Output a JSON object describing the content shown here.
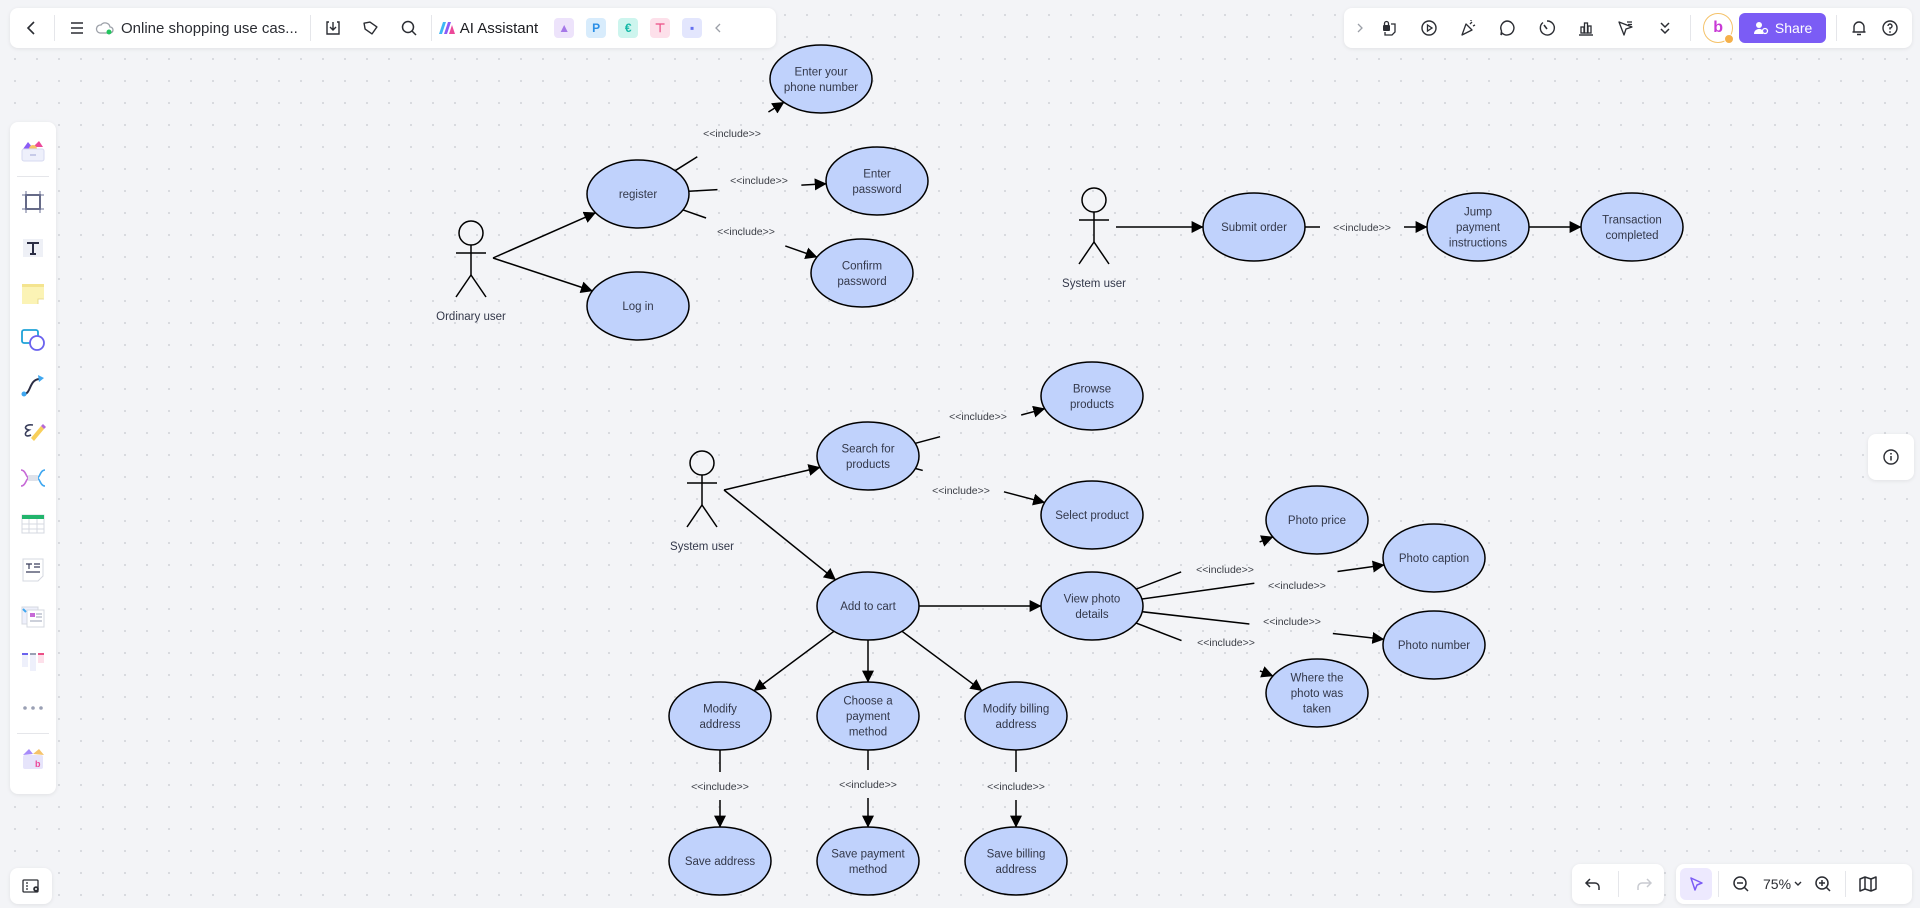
{
  "toolbar": {
    "doc_title": "Online shopping use cas...",
    "ai_assistant_label": "AI Assistant",
    "share_label": "Share",
    "zoom_level": "75%",
    "sync_status_color": "#22c55e",
    "accent_color": "#7b5cf5"
  },
  "app_shortcuts": [
    {
      "name": "image-generator",
      "glyph": "▲",
      "bg": "#ede3fb",
      "fg": "#a678e8"
    },
    {
      "name": "presentation",
      "glyph": "P",
      "bg": "#d8ecfc",
      "fg": "#2b8fe6"
    },
    {
      "name": "mindmap",
      "glyph": "€",
      "bg": "#cdf5ee",
      "fg": "#14b8a6"
    },
    {
      "name": "flowchart",
      "glyph": "⊤",
      "bg": "#fde0ea",
      "fg": "#ec4f86"
    },
    {
      "name": "chat",
      "glyph": "▪",
      "bg": "#e3e6fd",
      "fg": "#6470f0"
    }
  ],
  "diagram": {
    "ellipse_fill": "#c0d2fc",
    "stroke": "#000000",
    "include_label": "<<include>>",
    "actors": [
      {
        "id": "ordinary-user",
        "label": "Ordinary user"
      },
      {
        "id": "system-user-1",
        "label": "System user"
      },
      {
        "id": "system-user-2",
        "label": "System user"
      }
    ],
    "use_cases": [
      {
        "id": "register",
        "lines": [
          "register"
        ]
      },
      {
        "id": "log-in",
        "lines": [
          "Log in"
        ]
      },
      {
        "id": "enter-phone",
        "lines": [
          "Enter your",
          "phone number"
        ]
      },
      {
        "id": "enter-password",
        "lines": [
          "Enter",
          "password"
        ]
      },
      {
        "id": "confirm-password",
        "lines": [
          "Confirm",
          "password"
        ]
      },
      {
        "id": "submit-order",
        "lines": [
          "Submit order"
        ]
      },
      {
        "id": "jump-payment",
        "lines": [
          "Jump",
          "payment",
          "instructions"
        ]
      },
      {
        "id": "transaction-completed",
        "lines": [
          "Transaction",
          "completed"
        ]
      },
      {
        "id": "search-products",
        "lines": [
          "Search for",
          "products"
        ]
      },
      {
        "id": "browse-products",
        "lines": [
          "Browse",
          "products"
        ]
      },
      {
        "id": "select-product",
        "lines": [
          "Select product"
        ]
      },
      {
        "id": "add-to-cart",
        "lines": [
          "Add to cart"
        ]
      },
      {
        "id": "view-photo-details",
        "lines": [
          "View photo",
          "details"
        ]
      },
      {
        "id": "photo-price",
        "lines": [
          "Photo price"
        ]
      },
      {
        "id": "photo-caption",
        "lines": [
          "Photo caption"
        ]
      },
      {
        "id": "photo-number",
        "lines": [
          "Photo number"
        ]
      },
      {
        "id": "photo-location",
        "lines": [
          "Where the",
          "photo was",
          "taken"
        ]
      },
      {
        "id": "modify-address",
        "lines": [
          "Modify",
          "address"
        ]
      },
      {
        "id": "choose-payment",
        "lines": [
          "Choose a",
          "payment",
          "method"
        ]
      },
      {
        "id": "modify-billing",
        "lines": [
          "Modify billing",
          "address"
        ]
      },
      {
        "id": "save-address",
        "lines": [
          "Save address"
        ]
      },
      {
        "id": "save-payment",
        "lines": [
          "Save payment",
          "method"
        ]
      },
      {
        "id": "save-billing",
        "lines": [
          "Save billing",
          "address"
        ]
      }
    ],
    "relations": [
      {
        "from": "ordinary-user",
        "to": "register",
        "include": false
      },
      {
        "from": "ordinary-user",
        "to": "log-in",
        "include": false
      },
      {
        "from": "register",
        "to": "enter-phone",
        "include": true
      },
      {
        "from": "register",
        "to": "enter-password",
        "include": true
      },
      {
        "from": "register",
        "to": "confirm-password",
        "include": true
      },
      {
        "from": "system-user-1",
        "to": "submit-order",
        "include": false
      },
      {
        "from": "submit-order",
        "to": "jump-payment",
        "include": true
      },
      {
        "from": "jump-payment",
        "to": "transaction-completed",
        "include": false
      },
      {
        "from": "system-user-2",
        "to": "search-products",
        "include": false
      },
      {
        "from": "system-user-2",
        "to": "add-to-cart",
        "include": false
      },
      {
        "from": "search-products",
        "to": "browse-products",
        "include": true
      },
      {
        "from": "search-products",
        "to": "select-product",
        "include": true
      },
      {
        "from": "add-to-cart",
        "to": "view-photo-details",
        "include": false
      },
      {
        "from": "view-photo-details",
        "to": "photo-price",
        "include": true
      },
      {
        "from": "view-photo-details",
        "to": "photo-caption",
        "include": true
      },
      {
        "from": "view-photo-details",
        "to": "photo-number",
        "include": true
      },
      {
        "from": "view-photo-details",
        "to": "photo-location",
        "include": true
      },
      {
        "from": "add-to-cart",
        "to": "modify-address",
        "include": false
      },
      {
        "from": "add-to-cart",
        "to": "choose-payment",
        "include": false
      },
      {
        "from": "add-to-cart",
        "to": "modify-billing",
        "include": false
      },
      {
        "from": "modify-address",
        "to": "save-address",
        "include": true
      },
      {
        "from": "choose-payment",
        "to": "save-payment",
        "include": true
      },
      {
        "from": "modify-billing",
        "to": "save-billing",
        "include": true
      }
    ]
  }
}
